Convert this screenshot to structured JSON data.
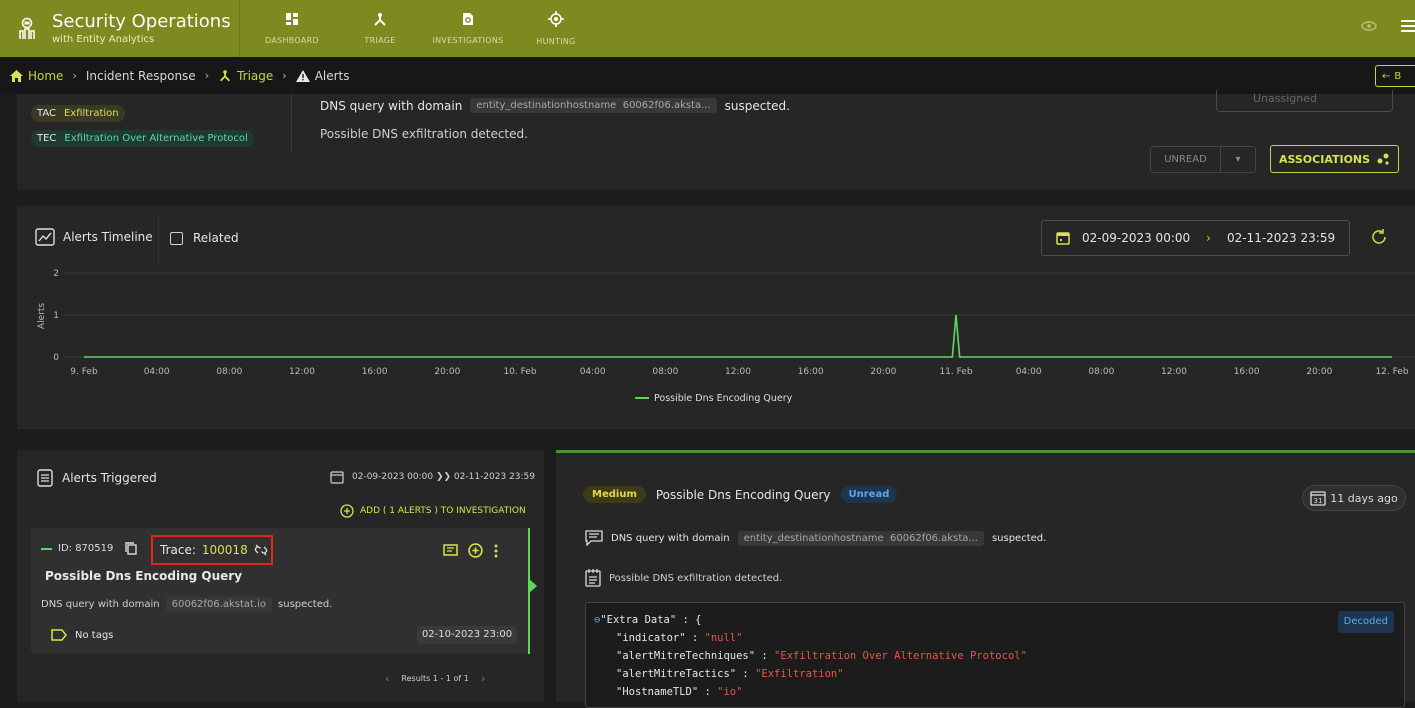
{
  "app": {
    "title": "Security Operations",
    "subtitle": "with Entity Analytics",
    "nav": [
      "DASHBOARD",
      "TRIAGE",
      "INVESTIGATIONS",
      "HUNTING"
    ]
  },
  "breadcrumb": {
    "home": "Home",
    "incident": "Incident Response",
    "triage": "Triage",
    "alerts": "Alerts",
    "back": "B"
  },
  "summary": {
    "tac_key": "TAC",
    "tac_val": "Exfiltration",
    "tec_key": "TEC",
    "tec_val": "Exfiltration Over Alternative Protocol",
    "desc_prefix": "DNS query with domain",
    "field": "entity_destinationhostname",
    "field_val": "60062f06.aksta...",
    "desc_suffix": "suspected.",
    "desc2": "Possible DNS exfiltration detected.",
    "assignee": "Unassigned",
    "unread": "UNREAD",
    "associations": "ASSOCIATIONS"
  },
  "timeline": {
    "title": "Alerts Timeline",
    "related": "Related",
    "date_from": "02-09-2023 00:00",
    "date_to": "02-11-2023 23:59"
  },
  "chart_data": {
    "type": "line",
    "ylabel": "Alerts",
    "yticks": [
      "0",
      "1",
      "2"
    ],
    "ylim": [
      0,
      2
    ],
    "xticks": [
      "9. Feb",
      "04:00",
      "08:00",
      "12:00",
      "16:00",
      "20:00",
      "10. Feb",
      "04:00",
      "08:00",
      "12:00",
      "16:00",
      "20:00",
      "11. Feb",
      "04:00",
      "08:00",
      "12:00",
      "16:00",
      "20:00",
      "12. Feb"
    ],
    "series": [
      {
        "name": "Possible Dns Encoding Query",
        "color": "#5fd65f",
        "points": [
          [
            0,
            0
          ],
          [
            47.8,
            0
          ],
          [
            48,
            1
          ],
          [
            48.2,
            0
          ],
          [
            72,
            0
          ]
        ]
      }
    ],
    "x_unit": "hours since 9. Feb 00:00",
    "legend": "bottom-center"
  },
  "alerts": {
    "title": "Alerts Triggered",
    "range": "02-09-2023 00:00 ❯❯ 02-11-2023 23:59",
    "add": "ADD ( 1 ALERTS ) TO INVESTIGATION",
    "item": {
      "id": "ID: 870519",
      "trace_label": "Trace:",
      "trace_value": "100018",
      "title": "Possible Dns Encoding Query",
      "desc_prefix": "DNS query with domain",
      "domain": "60062f06.akstat.io",
      "desc_suffix": "suspected.",
      "tags": "No tags",
      "date": "02-10-2023 23:00"
    },
    "pager": "Results 1 - 1 of 1"
  },
  "detail": {
    "severity": "Medium",
    "title": "Possible Dns Encoding Query",
    "status": "Unread",
    "age": "11 days ago",
    "desc_prefix": "DNS query with domain",
    "field": "entity_destinationhostname",
    "field_val": "60062f06.aksta...",
    "desc_suffix": "suspected.",
    "desc2": "Possible DNS exfiltration detected.",
    "decoded": "Decoded",
    "code_head": "\"Extra Data\" : {",
    "code_lines": [
      {
        "k": "\"indicator\" : ",
        "v": "\"null\""
      },
      {
        "k": "\"alertMitreTechniques\" : ",
        "v": "\"Exfiltration Over Alternative Protocol\""
      },
      {
        "k": "\"alertMitreTactics\" : ",
        "v": "\"Exfiltration\""
      },
      {
        "k": "\"HostnameTLD\" : ",
        "v": "\"io\""
      }
    ]
  }
}
